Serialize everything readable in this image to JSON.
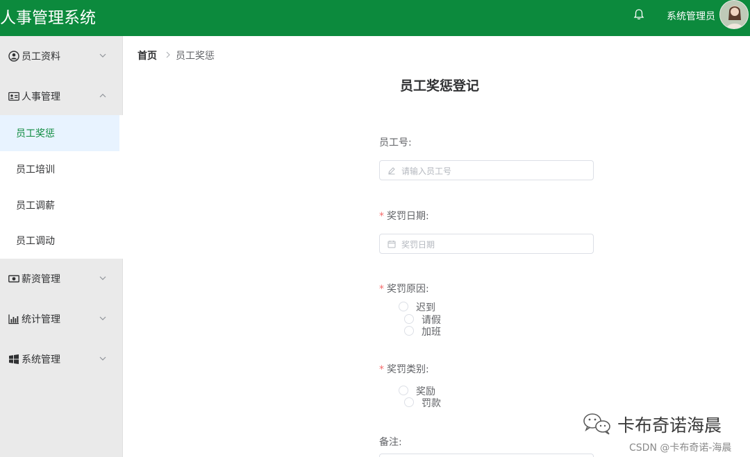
{
  "header": {
    "app_title": "人事管理系统",
    "user_name": "系统管理员",
    "brand_color": "#0c8a3d"
  },
  "sidebar": {
    "menus": [
      {
        "label": "员工资料",
        "icon": "user-circle-icon",
        "expanded": false
      },
      {
        "label": "人事管理",
        "icon": "id-card-icon",
        "expanded": true
      },
      {
        "label": "薪资管理",
        "icon": "money-icon",
        "expanded": false
      },
      {
        "label": "统计管理",
        "icon": "bar-chart-icon",
        "expanded": false
      },
      {
        "label": "系统管理",
        "icon": "windows-icon",
        "expanded": false
      }
    ],
    "submenu": [
      {
        "label": "员工奖惩",
        "active": true
      },
      {
        "label": "员工培训",
        "active": false
      },
      {
        "label": "员工调薪",
        "active": false
      },
      {
        "label": "员工调动",
        "active": false
      }
    ]
  },
  "breadcrumb": {
    "home": "首页",
    "current": "员工奖惩"
  },
  "form": {
    "title": "员工奖惩登记",
    "employee_id": {
      "label": "员工号:",
      "placeholder": "请输入员工号",
      "value": ""
    },
    "date": {
      "required_mark": "*",
      "label": "奖罚日期:",
      "placeholder": "奖罚日期",
      "value": ""
    },
    "reason": {
      "required_mark": "*",
      "label": "奖罚原因:",
      "options": [
        "迟到",
        "请假",
        "加班"
      ],
      "selected": null
    },
    "category": {
      "required_mark": "*",
      "label": "奖罚类别:",
      "options": [
        "奖励",
        "罚款"
      ],
      "selected": null
    },
    "remark": {
      "label": "备注:"
    }
  },
  "watermark": {
    "author": "卡布奇诺海晨",
    "source": "CSDN @卡布奇诺-海晨"
  }
}
